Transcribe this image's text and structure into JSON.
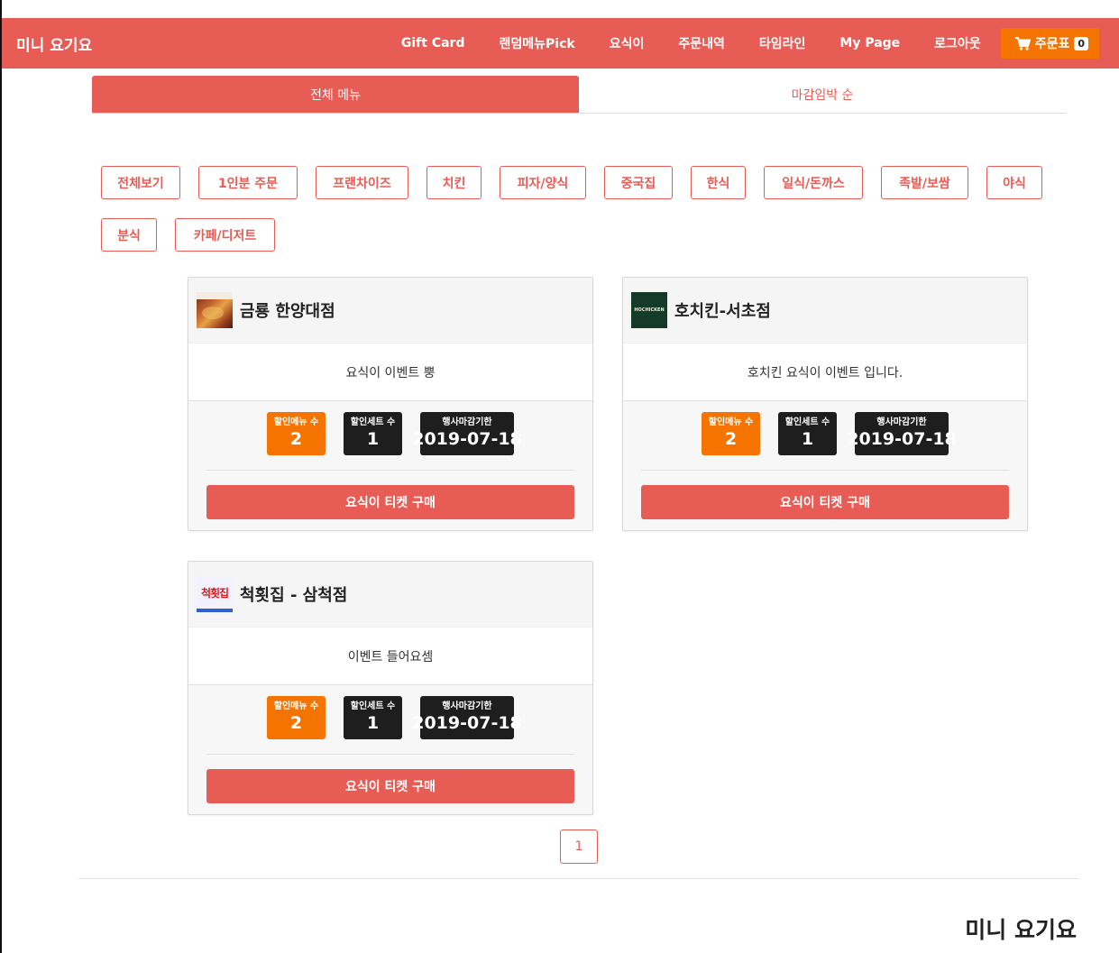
{
  "navbar": {
    "brand": "미니 요기요",
    "items": [
      "Gift Card",
      "랜덤메뉴Pick",
      "요식이",
      "주문내역",
      "타임라인",
      "My Page",
      "로그아웃"
    ],
    "cart": {
      "label": "주문표",
      "count": "0"
    }
  },
  "tabs": {
    "all": "전체 메뉴",
    "deadline": "마감임박 순"
  },
  "categories": [
    "전체보기",
    "1인분 주문",
    "프랜차이즈",
    "치킨",
    "피자/양식",
    "중국집",
    "한식",
    "일식/돈까스",
    "족발/보쌈",
    "야식",
    "분식",
    "카페/디저트"
  ],
  "stat_labels": {
    "menus": "할인메뉴 수",
    "sets": "할인세트 수",
    "deadline": "행사마감기한"
  },
  "ticket_label": "요식이 티켓 구매",
  "stores": [
    {
      "name": "금룡 한양대점",
      "description": "요식이 이벤트 뿡",
      "discount_menus": "2",
      "discount_sets": "1",
      "deadline": "2019-07-18"
    },
    {
      "name": "호치킨-서초점",
      "description": "호치킨 요식이 이벤트 입니다.",
      "discount_menus": "2",
      "discount_sets": "1",
      "deadline": "2019-07-18",
      "logo_text": "HOCHICKEN"
    },
    {
      "name": "척횟집 - 삼척점",
      "description": "이벤트 들어요셈",
      "discount_menus": "2",
      "discount_sets": "1",
      "deadline": "2019-07-18",
      "logo_text": "척횟집"
    }
  ],
  "pagination": {
    "current": "1"
  },
  "footer": {
    "brand": "미니 요기요"
  },
  "colors": {
    "primary": "#e85c56",
    "accent": "#f57400",
    "dark": "#1e1e1e"
  }
}
